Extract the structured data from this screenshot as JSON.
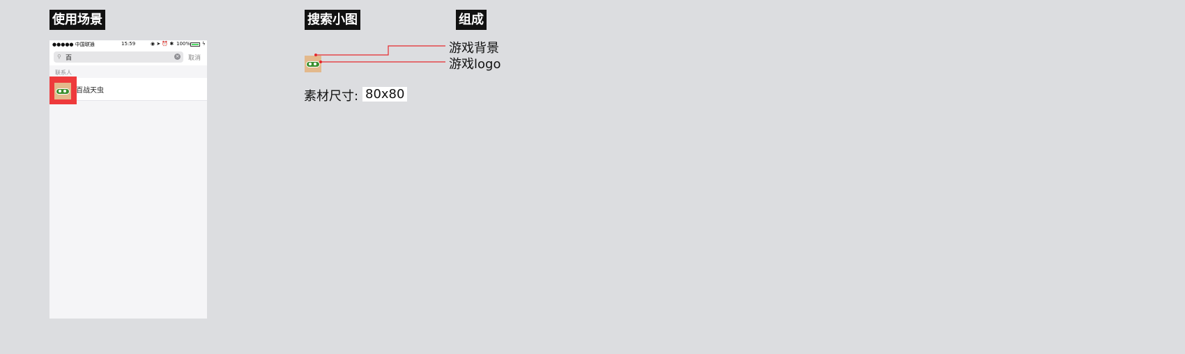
{
  "headers": {
    "usage": "使用场景",
    "thumb": "搜索小图",
    "compose": "组成"
  },
  "phone": {
    "status": {
      "carrier": "●●●●● 中国联通",
      "time": "15:59",
      "battery": "100%",
      "battery_level": 1.0
    },
    "search": {
      "value": "百",
      "cancel": "取消"
    },
    "section_label": "联系人",
    "result_label": "百战天虫"
  },
  "callouts": {
    "background": "游戏背景",
    "logo": "游戏logo"
  },
  "size": {
    "label": "素材尺寸:",
    "value": "80x80"
  },
  "colors": {
    "highlight": "#ee3a3c",
    "line": "#e5282c",
    "bg": "#dcdde0"
  }
}
